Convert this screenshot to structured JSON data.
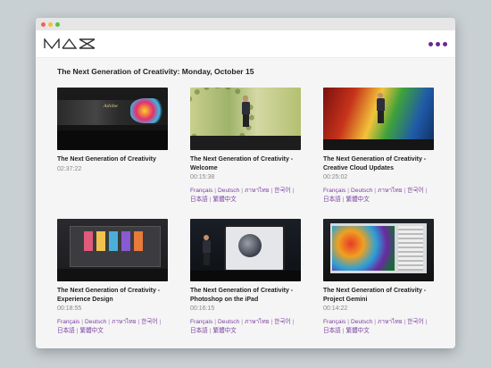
{
  "window": {
    "dots": [
      "#f4605a",
      "#f6be3b",
      "#57c43f"
    ]
  },
  "header": {
    "logo": "MAX",
    "more_icon": "more-dots-icon",
    "accent": "#6c2a8e"
  },
  "page_title": "The Next Generation of Creativity: Monday, October 15",
  "videos": [
    {
      "title": "The Next Generation of Creativity",
      "duration": "02:37:22",
      "languages": []
    },
    {
      "title": "The Next Generation of Creativity - Welcome",
      "duration": "00:15:38",
      "languages": [
        "Français",
        "Deutsch",
        "ภาษาไทย",
        "한국어",
        "日本語",
        "繁體中文"
      ]
    },
    {
      "title": "The Next Generation of Creativity - Creative Cloud Updates",
      "duration": "00:25:02",
      "languages": [
        "Français",
        "Deutsch",
        "ภาษาไทย",
        "한국어",
        "日本語",
        "繁體中文"
      ]
    },
    {
      "title": "The Next Generation of Creativity - Experience Design",
      "duration": "00:18:55",
      "languages": [
        "Français",
        "Deutsch",
        "ภาษาไทย",
        "한국어",
        "日本語",
        "繁體中文"
      ]
    },
    {
      "title": "The Next Generation of Creativity - Photoshop on the iPad",
      "duration": "00:16:15",
      "languages": [
        "Français",
        "Deutsch",
        "ภาษาไทย",
        "한국어",
        "日本語",
        "繁體中文"
      ]
    },
    {
      "title": "The Next Generation of Creativity - Project Gemini",
      "duration": "00:14:22",
      "languages": [
        "Français",
        "Deutsch",
        "ภาษาไทย",
        "한국어",
        "日本語",
        "繁體中文"
      ]
    }
  ]
}
